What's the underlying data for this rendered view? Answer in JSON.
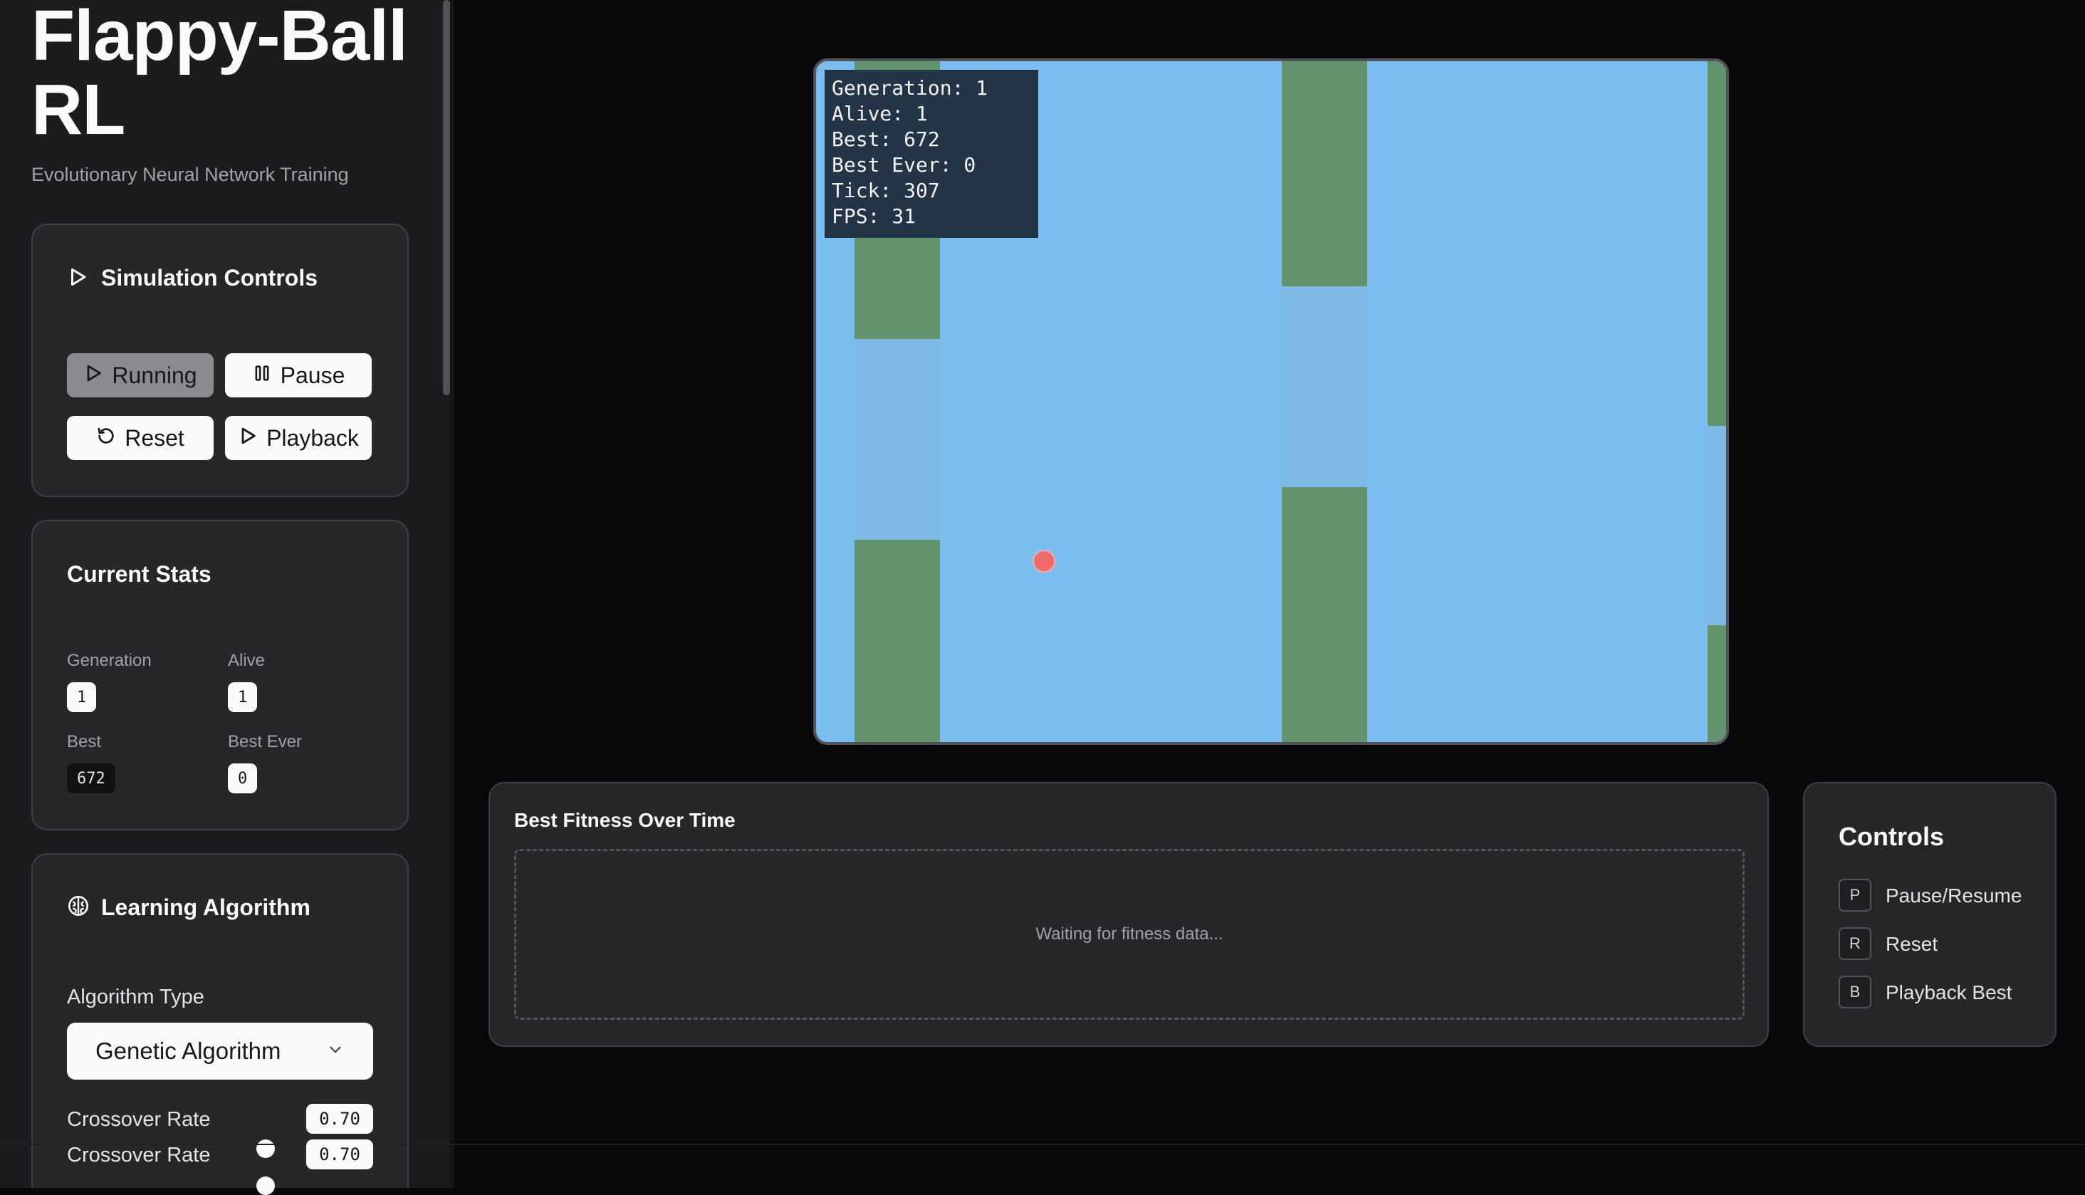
{
  "app": {
    "title": "Flappy-Ball RL",
    "subtitle": "Evolutionary Neural Network Training"
  },
  "simulation_controls": {
    "title": "Simulation Controls",
    "running_label": "Running",
    "pause_label": "Pause",
    "reset_label": "Reset",
    "playback_label": "Playback"
  },
  "current_stats": {
    "title": "Current Stats",
    "generation_label": "Generation",
    "generation_value": "1",
    "alive_label": "Alive",
    "alive_value": "1",
    "best_label": "Best",
    "best_value": "672",
    "best_ever_label": "Best Ever",
    "best_ever_value": "0"
  },
  "learning_algorithm": {
    "title": "Learning Algorithm",
    "algorithm_type_label": "Algorithm Type",
    "algorithm_type_value": "Genetic Algorithm",
    "crossover_label": "Crossover Rate",
    "crossover_value": "0.70",
    "crossover_label_2": "Crossover Rate",
    "crossover_value_2": "0.70"
  },
  "game_hud": {
    "generation": "Generation: 1",
    "alive": "Alive: 1",
    "best": "Best: 672",
    "best_ever": "Best Ever: 0",
    "tick": "Tick: 307",
    "fps": "FPS: 31"
  },
  "fitness_chart": {
    "title": "Best Fitness Over Time",
    "empty_message": "Waiting for fitness data..."
  },
  "controls_legend": {
    "title": "Controls",
    "items": [
      {
        "key": "P",
        "label": "Pause/Resume"
      },
      {
        "key": "R",
        "label": "Reset"
      },
      {
        "key": "B",
        "label": "Playback Best"
      }
    ]
  },
  "colors": {
    "sky": "#7bbdee",
    "pipe": "#62936c",
    "ball": "#ef6a6a",
    "hud_background": "#233447"
  }
}
